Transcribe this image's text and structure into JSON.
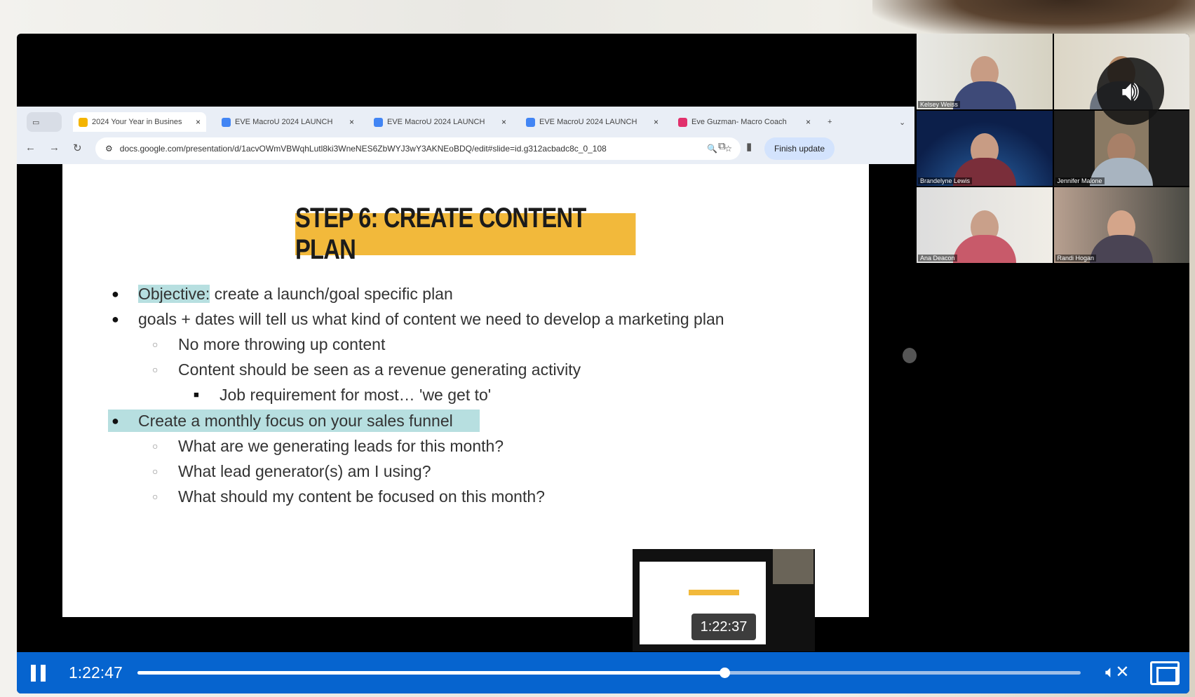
{
  "browser": {
    "tabs": [
      {
        "label": "2024 Your Year in Busines",
        "color": "#f4b400"
      },
      {
        "label": "EVE MacroU 2024 LAUNCH",
        "color": "#4285f4"
      },
      {
        "label": "EVE MacroU 2024 LAUNCH",
        "color": "#4285f4"
      },
      {
        "label": "EVE MacroU 2024 LAUNCH",
        "color": "#4285f4"
      },
      {
        "label": "Eve Guzman- Macro Coach",
        "color": "#e1306c"
      }
    ],
    "close": "×",
    "new_tab": "+",
    "tab_menu": "⌄",
    "url": "docs.google.com/presentation/d/1acvOWmVBWqhLutl8ki3WneNES6ZbWYJ3wY3AKNEoBDQ/edit#slide=id.g312acbadc8c_0_108",
    "finish_update": "Finish update"
  },
  "slide": {
    "title": "STEP 6: CREATE CONTENT PLAN",
    "bullets": [
      {
        "highlight": "Objective:",
        "text": " create a launch/goal specific plan"
      },
      {
        "text": "goals + dates will tell us what kind of content we need to develop a marketing plan"
      },
      {
        "text": "No more throwing up content"
      },
      {
        "text": "Content should be seen as a revenue generating activity"
      },
      {
        "text": "Job requirement for most… 'we get to'"
      },
      {
        "text": "Create a monthly focus on your sales funnel"
      },
      {
        "text": "What are we generating leads for this month?"
      },
      {
        "text": "What lead generator(s) am I using?"
      },
      {
        "text": "What should my content be focused on this month?"
      }
    ],
    "markers": {
      "l1": "●",
      "l2": "○",
      "l3": "■"
    }
  },
  "participants": [
    "Kelsey Weiss",
    "",
    "Brandelyne Lewis",
    "Jennifer Malone",
    "Ana Deacon",
    "Randi Hogan"
  ],
  "player": {
    "current_time": "1:22:47",
    "hover_time": "1:22:37",
    "progress": 0.622,
    "accent": "#0664cf"
  }
}
